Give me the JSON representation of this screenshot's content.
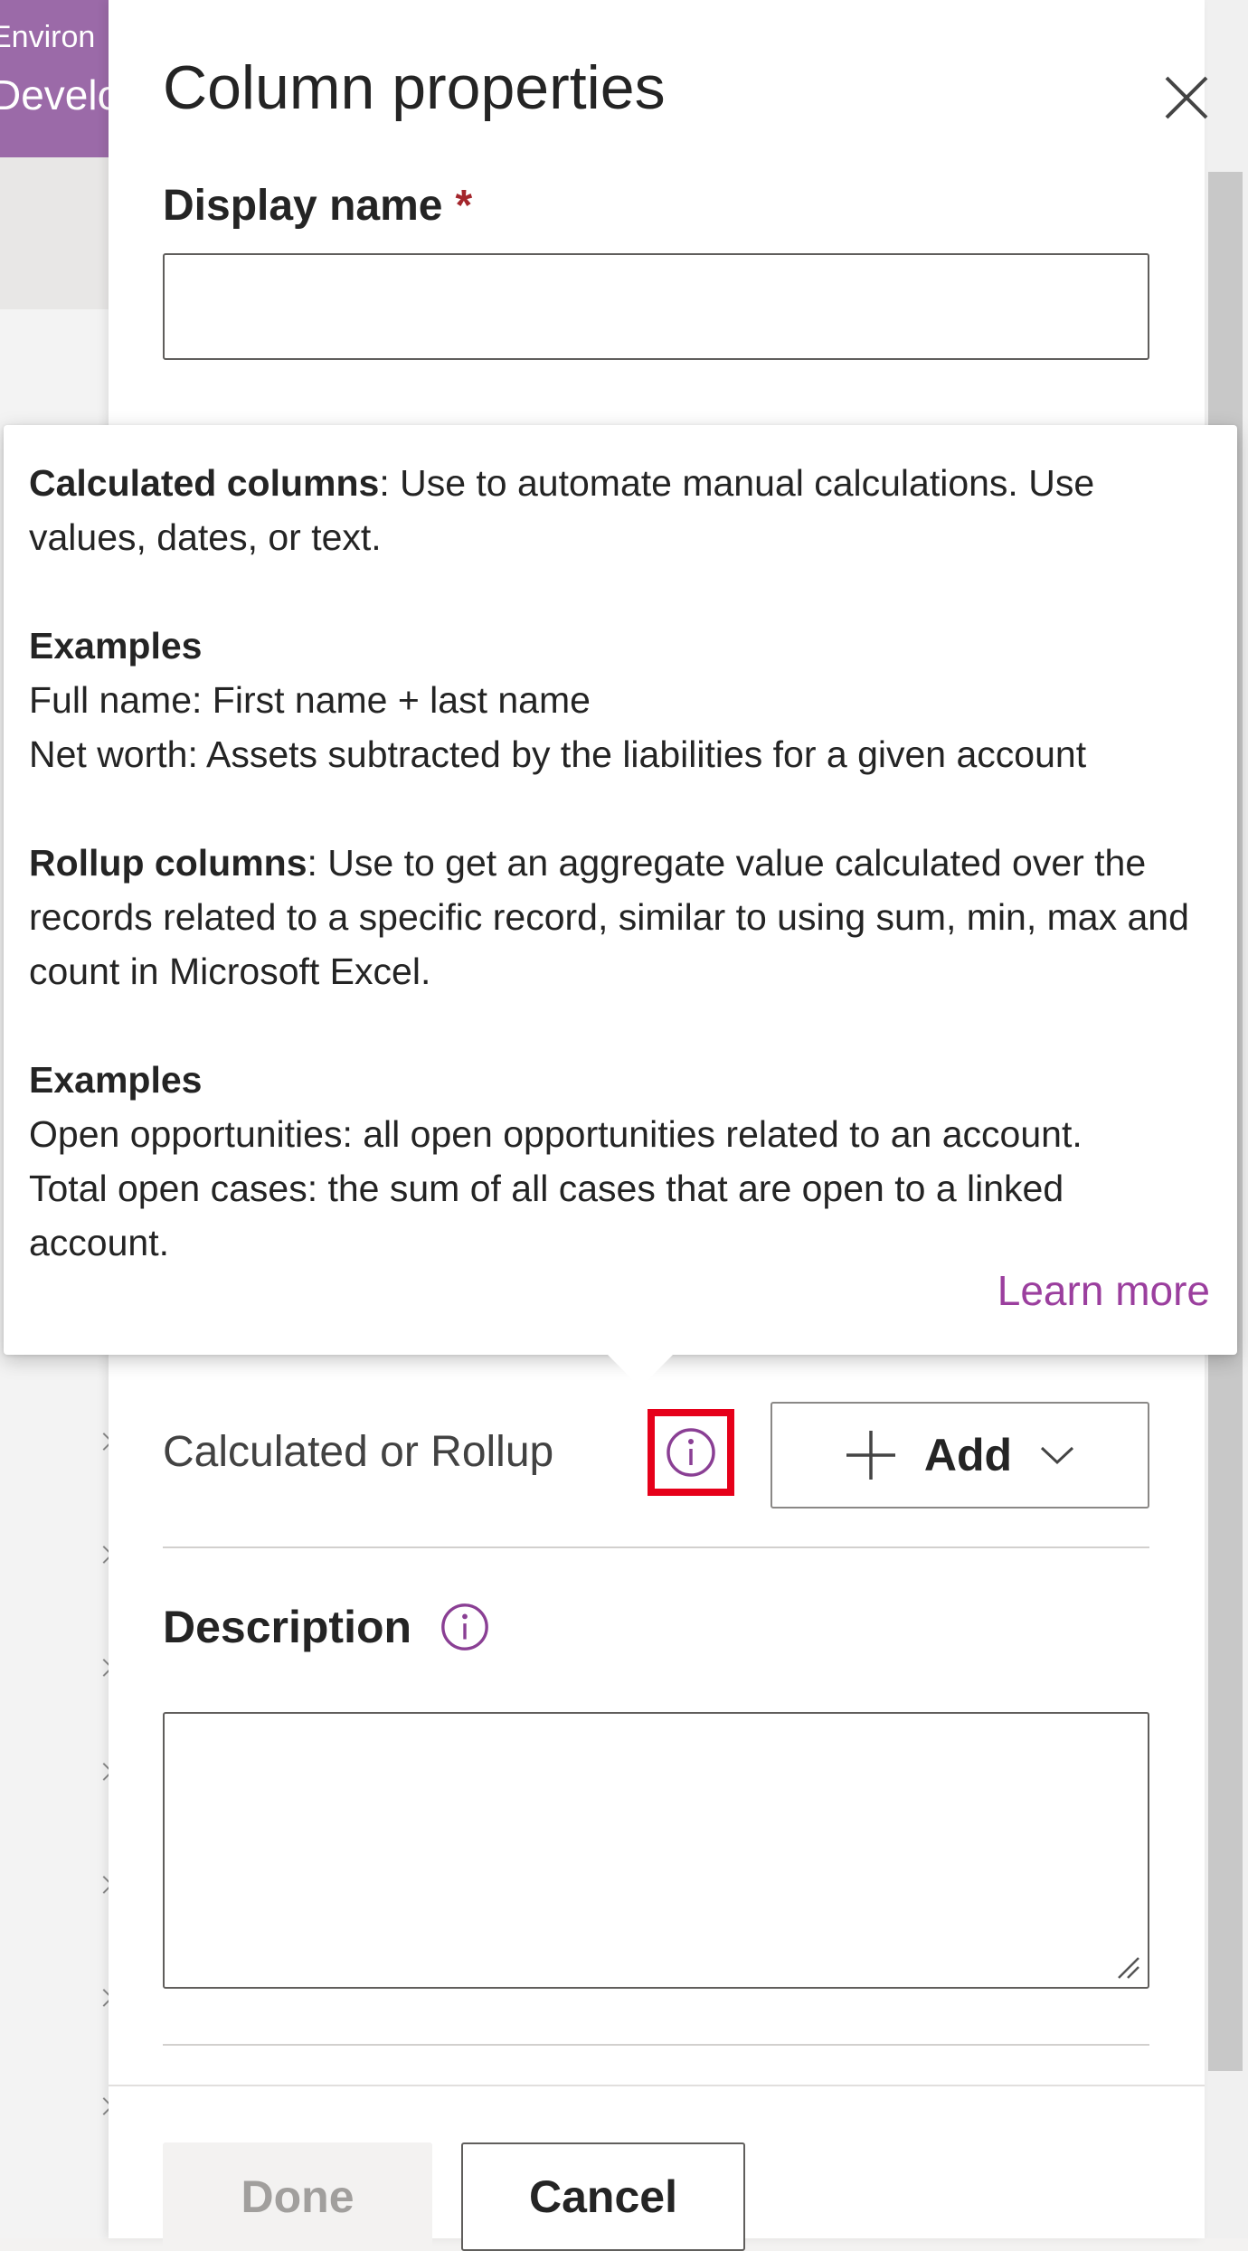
{
  "environment": {
    "label": "Environ",
    "name": "Develo"
  },
  "panel": {
    "title": "Column properties",
    "display_name_label": "Display name",
    "required_mark": "*",
    "display_name_value": "",
    "calculated_label": "Calculated or Rollup",
    "add_button_label": "Add",
    "description_label": "Description",
    "description_value": ""
  },
  "tooltip": {
    "calc_heading": "Calculated columns",
    "calc_text": ": Use to automate manual calculations. Use values, dates, or text.",
    "examples_heading_1": "Examples",
    "example_1a": "Full name: First name + last name",
    "example_1b": "Net worth: Assets subtracted by the liabilities for a given account",
    "rollup_heading": "Rollup columns",
    "rollup_text": ": Use to get an aggregate value calculated over the records related to a specific record, similar to using sum, min, max and count in Microsoft Excel.",
    "examples_heading_2": "Examples",
    "example_2a": "Open opportunities: all open opportunities related to an account.",
    "example_2b": "Total open cases: the sum of all cases that are open to a linked account.",
    "learn_more": "Learn more"
  },
  "footer": {
    "done_label": "Done",
    "cancel_label": "Cancel"
  },
  "colors": {
    "accent": "#9b3f9e",
    "highlight": "#e6001a",
    "required": "#a4262c"
  },
  "icons": {
    "close": "close-icon",
    "info": "info-icon",
    "add": "plus-icon",
    "dropdown": "chevron-down-icon"
  }
}
